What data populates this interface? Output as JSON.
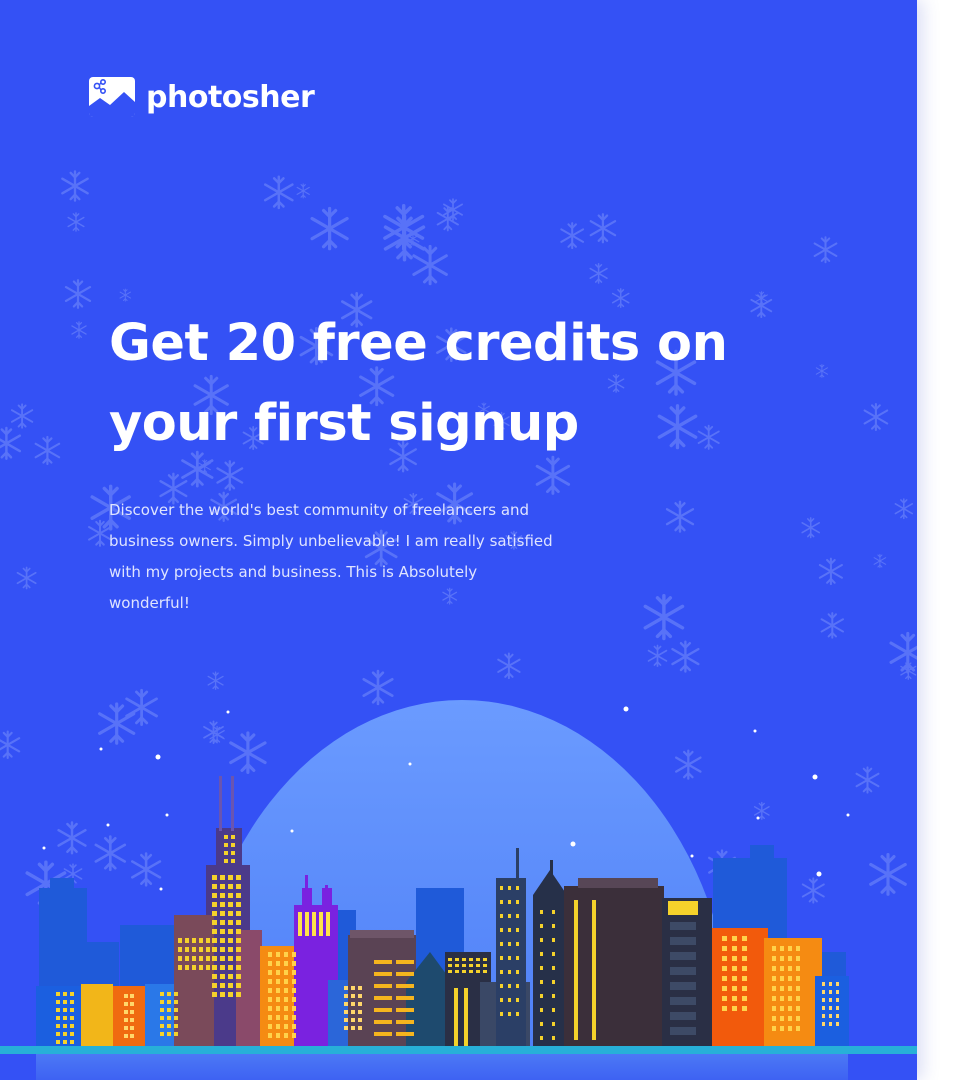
{
  "brand": {
    "name": "photosher",
    "logo_icon": "photo-share-icon"
  },
  "hero": {
    "headline_line1": "Get 20 free credits on",
    "headline_line2": "your first signup",
    "description": "Discover the world's best community of freelancers and business owners. Simply unbelievable! I am really satisfied with my projects and business. This is Absolutely wonderful!"
  },
  "illustration": {
    "name": "night-city-skyline",
    "colors": {
      "background": "#3451F5",
      "moon": "#5E8FFB",
      "ground": "#27B0D8"
    }
  }
}
